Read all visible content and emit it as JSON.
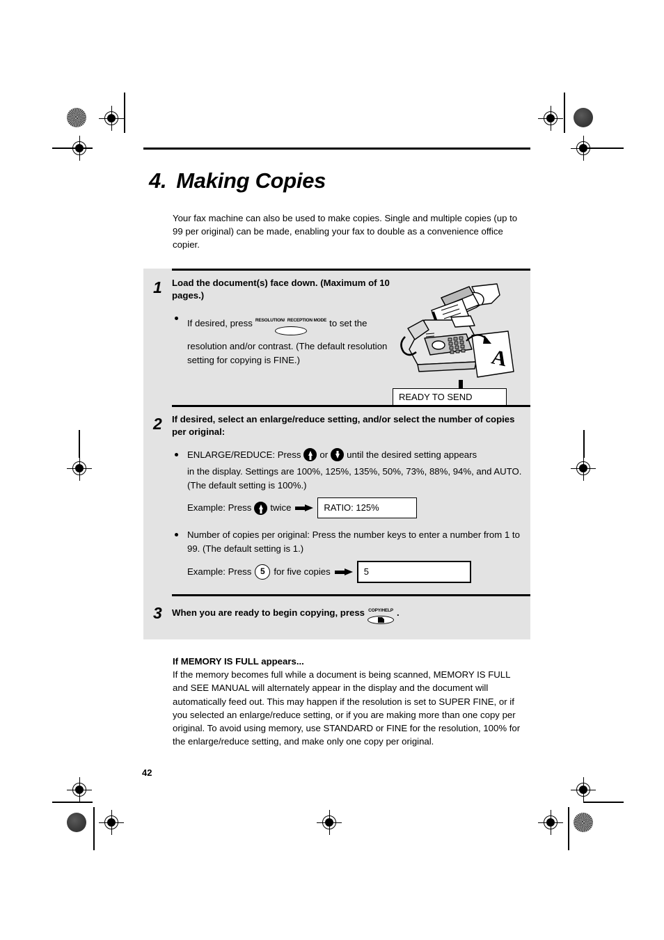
{
  "document": {
    "chapter_number": "4.",
    "chapter_title": "Making Copies",
    "intro": "Your fax machine can also be used to make copies. Single and multiple copies (up to 99 per original) can be made, enabling your fax to double as a convenience office copier.",
    "page_number": "42"
  },
  "steps": [
    {
      "number": "1",
      "title": "Load the document(s) face down. (Maximum of 10 pages.)",
      "bullet_before": "If desired, press",
      "key_label_line1": "RESOLUTION/",
      "key_label_line2": "RECEPTION MODE",
      "bullet_after": "to set the",
      "bullet_rest": "resolution and/or contrast. (The default resolution setting for copying is FINE.)",
      "display_text": "READY TO SEND"
    },
    {
      "number": "2",
      "title": "If desired, select an enlarge/reduce setting, and/or select the number of copies per original:",
      "bullet1_a": "ENLARGE/REDUCE: Press",
      "bullet1_or": "or",
      "bullet1_b": "until the desired setting appears",
      "bullet1_rest": "in the display. Settings are 100%, 125%, 135%, 50%, 73%, 88%, 94%, and AUTO. (The default setting is 100%.)",
      "example1_prefix": "Example: Press",
      "example1_suffix": "twice",
      "example1_display": "RATIO: 125%",
      "bullet2": "Number of copies per original: Press the number keys to enter a number from 1 to 99. (The default setting is 1.)",
      "example2_prefix": "Example: Press",
      "example2_key": "5",
      "example2_suffix": "for five copies",
      "example2_display": "5"
    },
    {
      "number": "3",
      "title_before": "When you are ready to begin copying, press",
      "key_label": "COPY/HELP",
      "title_after": "."
    }
  ],
  "memory_note": {
    "heading": "If MEMORY IS FULL appears...",
    "body": "If the memory becomes full while a document is being scanned, MEMORY IS FULL and SEE MANUAL will alternately appear in the display and the document will automatically feed out. This may happen if the resolution is set to SUPER FINE, or if you selected an enlarge/reduce setting, or if you are making more than one copy per original. To avoid using memory, use STANDARD or FINE for the resolution, 100% for the enlarge/reduce setting, and make only one copy per original."
  },
  "colors": {
    "panel_background": "#e3e3e3",
    "rule": "#000000",
    "page_background": "#ffffff"
  }
}
